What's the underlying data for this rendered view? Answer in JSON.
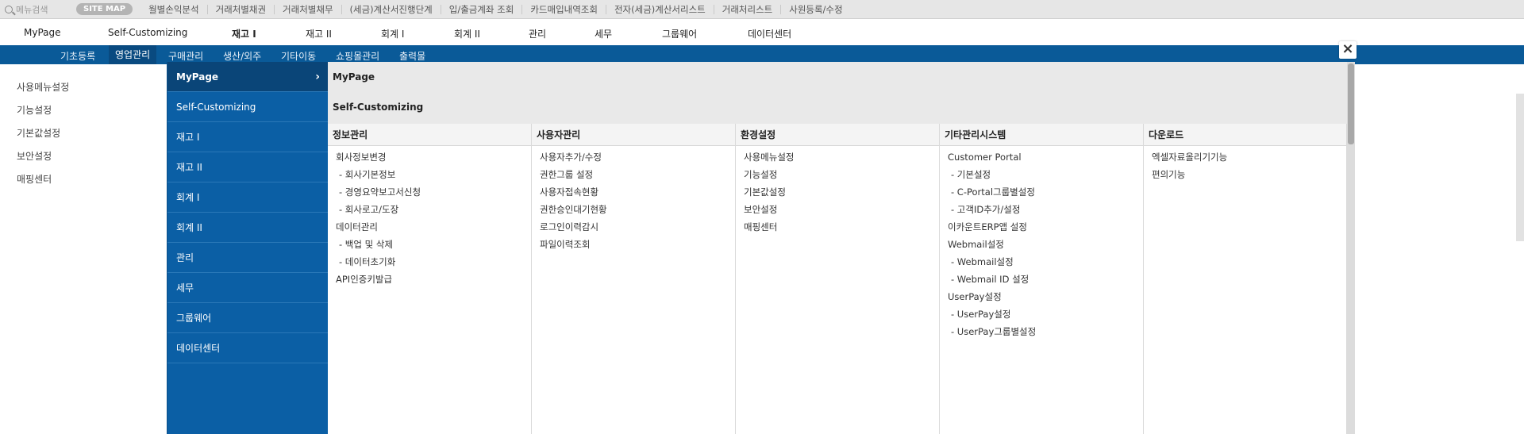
{
  "quickbar": {
    "search_placeholder": "메뉴검색",
    "sitemap_label": "SITE MAP",
    "links": [
      "월별손익분석",
      "거래처별채권",
      "거래처별채무",
      "(세금)계산서진행단계",
      "입/출금계좌 조회",
      "카드매입내역조회",
      "전자(세금)계산서리스트",
      "거래처리스트",
      "사원등록/수정"
    ]
  },
  "mainmenu": {
    "items": [
      "MyPage",
      "Self-Customizing",
      "재고 I",
      "재고 II",
      "회계 I",
      "회계 II",
      "관리",
      "세무",
      "그룹웨어",
      "데이터센터"
    ],
    "active_index": 2
  },
  "submenu": {
    "items": [
      "기초등록",
      "영업관리",
      "구매관리",
      "생산/외주",
      "기타이동",
      "쇼핑몰관리",
      "출력물"
    ],
    "active_index": 1
  },
  "leftmenu": {
    "items": [
      "사용메뉴설정",
      "기능설정",
      "기본값설정",
      "보안설정",
      "매핑센터"
    ]
  },
  "overlay": {
    "close_label": "×",
    "side_items": [
      "MyPage",
      "Self-Customizing",
      "재고 I",
      "재고 II",
      "회계 I",
      "회계 II",
      "관리",
      "세무",
      "그룹웨어",
      "데이터센터"
    ],
    "side_active_index": 0,
    "side_active_chevron": "›",
    "headings": [
      "MyPage",
      "Self-Customizing"
    ],
    "columns": [
      {
        "title": "정보관리",
        "items": [
          "회사정보변경",
          "- 회사기본정보",
          "- 경영요약보고서신청",
          "- 회사로고/도장",
          "데이터관리",
          "- 백업 및 삭제",
          "- 데이터초기화",
          "API인증키발급"
        ]
      },
      {
        "title": "사용자관리",
        "items": [
          "사용자추가/수정",
          "권한그룹 설정",
          "사용자접속현황",
          "권한승인대기현황",
          "로그인이력감시",
          "파일이력조회"
        ]
      },
      {
        "title": "환경설정",
        "items": [
          "사용메뉴설정",
          "기능설정",
          "기본값설정",
          "보안설정",
          "매핑센터"
        ]
      },
      {
        "title": "기타관리시스템",
        "items": [
          "Customer Portal",
          "- 기본설정",
          "- C-Portal그룹별설정",
          "- 고객ID추가/설정",
          "이카운트ERP앱 설정",
          "Webmail설정",
          "- Webmail설정",
          "- Webmail ID 설정",
          "UserPay설정",
          "- UserPay설정",
          "- UserPay그룹별설정"
        ]
      },
      {
        "title": "다운로드",
        "items": [
          "엑셀자료올리기기능",
          "편의기능"
        ]
      }
    ]
  }
}
